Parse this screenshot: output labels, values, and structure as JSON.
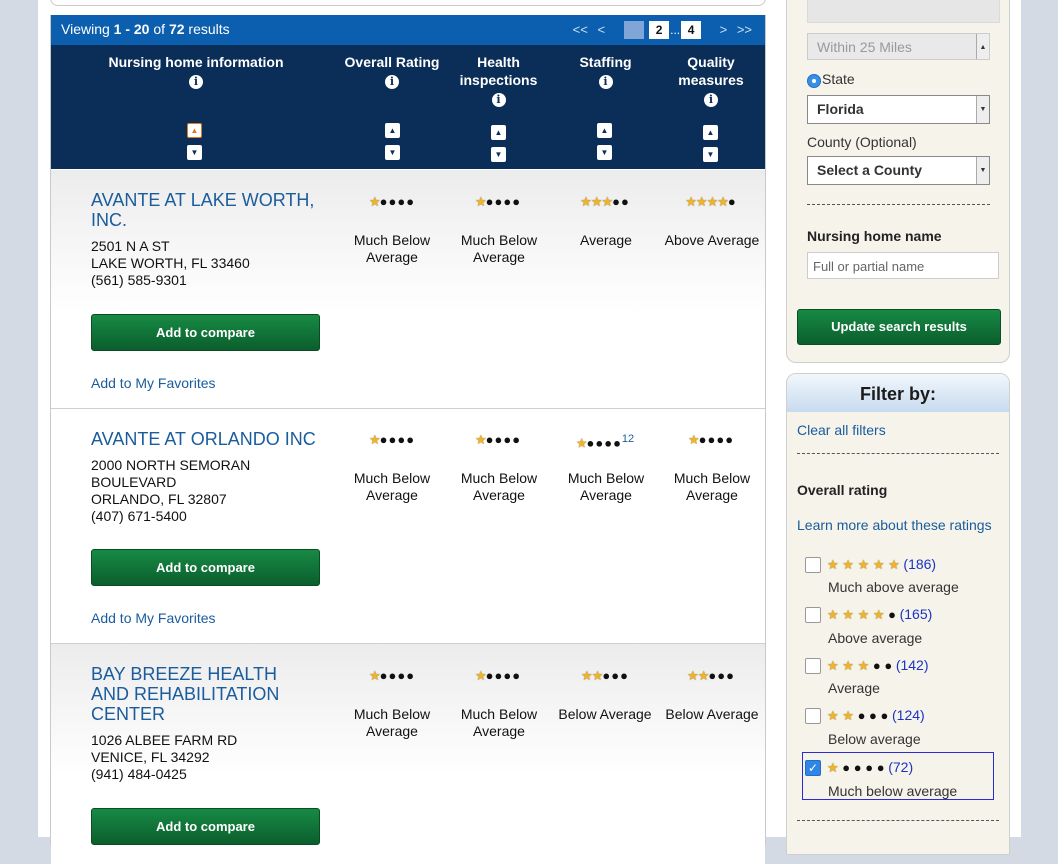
{
  "results": {
    "viewing_prefix": "Viewing ",
    "viewing_range": "1 - 20",
    "viewing_of": " of ",
    "viewing_total": "72",
    "viewing_suffix": " results",
    "pager": {
      "first": "<<",
      "prev": "<",
      "pages": [
        "1",
        "2",
        "...",
        "4"
      ],
      "next": ">",
      "last": ">>"
    }
  },
  "columns": [
    {
      "label": "Nursing home information"
    },
    {
      "label": "Overall Rating"
    },
    {
      "label": "Health inspections"
    },
    {
      "label": "Staffing"
    },
    {
      "label": "Quality measures"
    }
  ],
  "facilities": [
    {
      "name": "AVANTE AT LAKE WORTH, INC.",
      "address_lines": [
        "2501 N A ST",
        "LAKE WORTH, FL 33460",
        "(561) 585-9301"
      ],
      "compare_label": "Add to compare",
      "favorite_label": "Add to My Favorites",
      "ratings": [
        {
          "stars": 1,
          "label": "Much Below Average"
        },
        {
          "stars": 1,
          "label": "Much Below Average"
        },
        {
          "stars": 3,
          "label": "Average"
        },
        {
          "stars": 4,
          "label": "Above Average"
        }
      ]
    },
    {
      "name": "AVANTE AT ORLANDO INC",
      "address_lines": [
        "2000 NORTH SEMORAN",
        "BOULEVARD",
        "ORLANDO, FL 32807",
        "(407) 671-5400"
      ],
      "compare_label": "Add to compare",
      "favorite_label": "Add to My Favorites",
      "ratings": [
        {
          "stars": 1,
          "label": "Much Below Average"
        },
        {
          "stars": 1,
          "label": "Much Below Average"
        },
        {
          "stars": 1,
          "label": "Much Below Average",
          "footnote": "12"
        },
        {
          "stars": 1,
          "label": "Much Below Average"
        }
      ]
    },
    {
      "name": "BAY BREEZE HEALTH AND REHABILITATION CENTER",
      "address_lines": [
        "1026 ALBEE FARM RD",
        "VENICE, FL 34292",
        "(941) 484-0425"
      ],
      "compare_label": "Add to compare",
      "ratings": [
        {
          "stars": 1,
          "label": "Much Below Average"
        },
        {
          "stars": 1,
          "label": "Much Below Average"
        },
        {
          "stars": 2,
          "label": "Below Average"
        },
        {
          "stars": 2,
          "label": "Below Average"
        }
      ]
    }
  ],
  "sidebar": {
    "distance_select": "Within 25 Miles",
    "state_radio_label": "State",
    "state_select": "Florida",
    "county_label": "County (Optional)",
    "county_select": "Select a County",
    "name_label": "Nursing home name",
    "name_placeholder": "Full or partial name",
    "update_button": "Update search results"
  },
  "filter": {
    "title": "Filter by:",
    "clear_link": "Clear all filters",
    "overall_label": "Overall rating",
    "learn_link": "Learn more about these ratings",
    "options": [
      {
        "stars": 5,
        "count": "(186)",
        "label": "Much above average",
        "checked": false
      },
      {
        "stars": 4,
        "count": "(165)",
        "label": "Above average",
        "checked": false
      },
      {
        "stars": 3,
        "count": "(142)",
        "label": "Average",
        "checked": false
      },
      {
        "stars": 2,
        "count": "(124)",
        "label": "Below average",
        "checked": false
      },
      {
        "stars": 1,
        "count": "(72)",
        "label": "Much below average",
        "checked": true
      }
    ]
  },
  "colors": {
    "header_bar": "#0b5fae",
    "header_dark": "#0a2e57",
    "link": "#1a5c9c",
    "button_green": "#0b5e2c",
    "star": "#f0b429"
  }
}
